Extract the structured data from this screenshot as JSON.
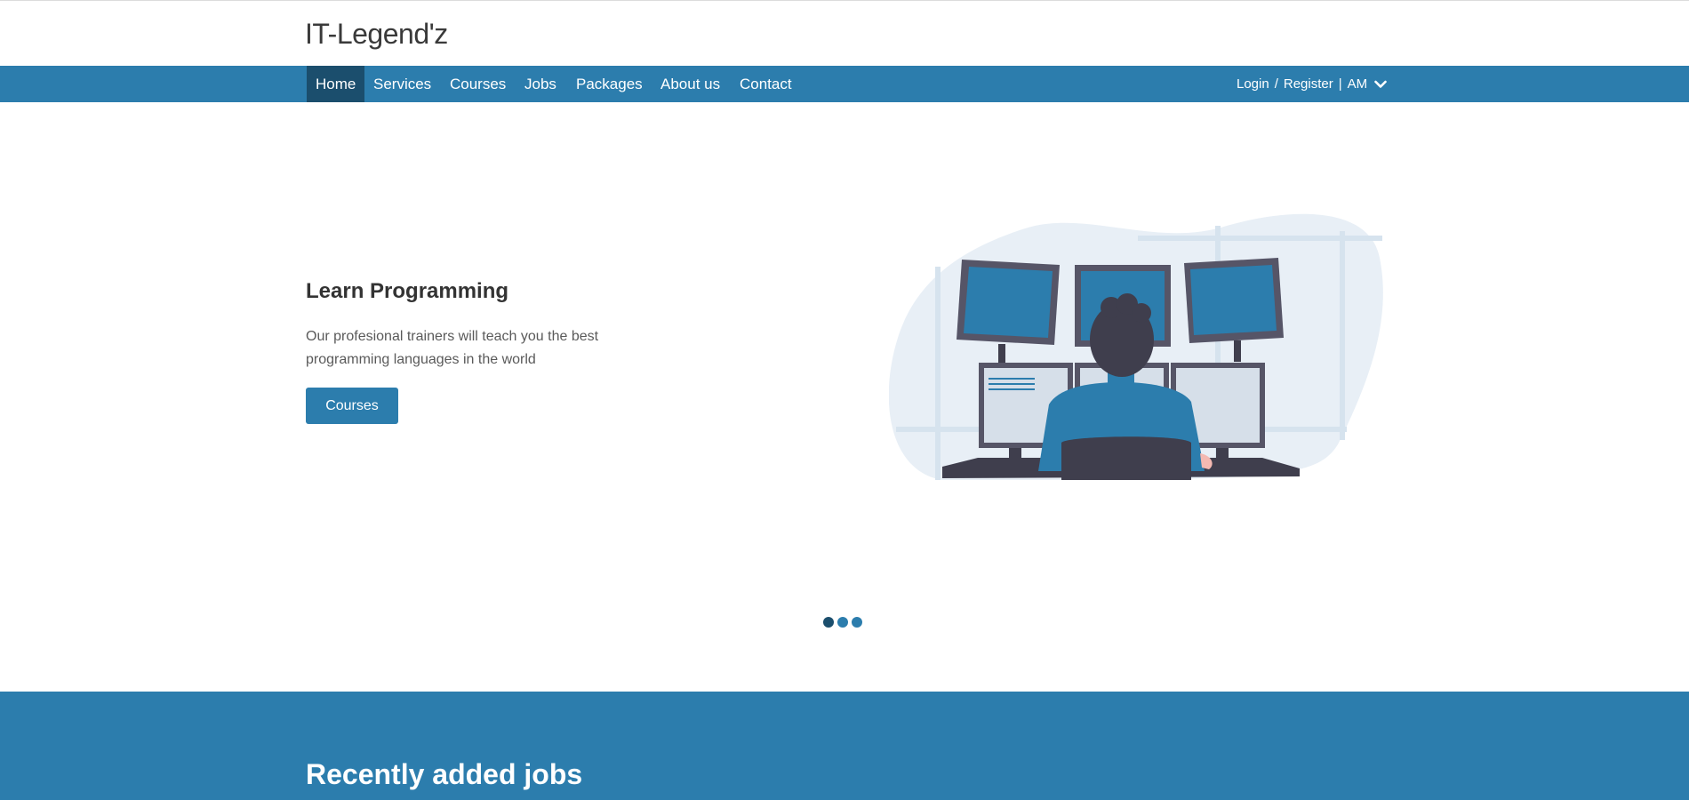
{
  "brand": {
    "logo_text": "IT-Legend'z",
    "accent": "#2c7dad",
    "dark_accent": "#1b4e6d"
  },
  "nav": {
    "items": [
      {
        "label": "Home",
        "active": true
      },
      {
        "label": "Services"
      },
      {
        "label": "Courses"
      },
      {
        "label": "Jobs"
      },
      {
        "label": "Packages"
      },
      {
        "label": "About us"
      },
      {
        "label": "Contact"
      }
    ],
    "login": "Login",
    "separator": "/",
    "register": "Register",
    "pipe": "|",
    "language": "AM",
    "language_icon": "chevron-down-icon"
  },
  "hero": {
    "title": "Learn Programming",
    "subtitle": "Our profesional trainers will teach you the best programming languages in the world",
    "button_label": "Courses",
    "illustration": "man-at-monitors-illustration"
  },
  "carousel": {
    "slide_count": 3,
    "active_index": 0
  },
  "jobs": {
    "title": "Recently added jobs"
  }
}
